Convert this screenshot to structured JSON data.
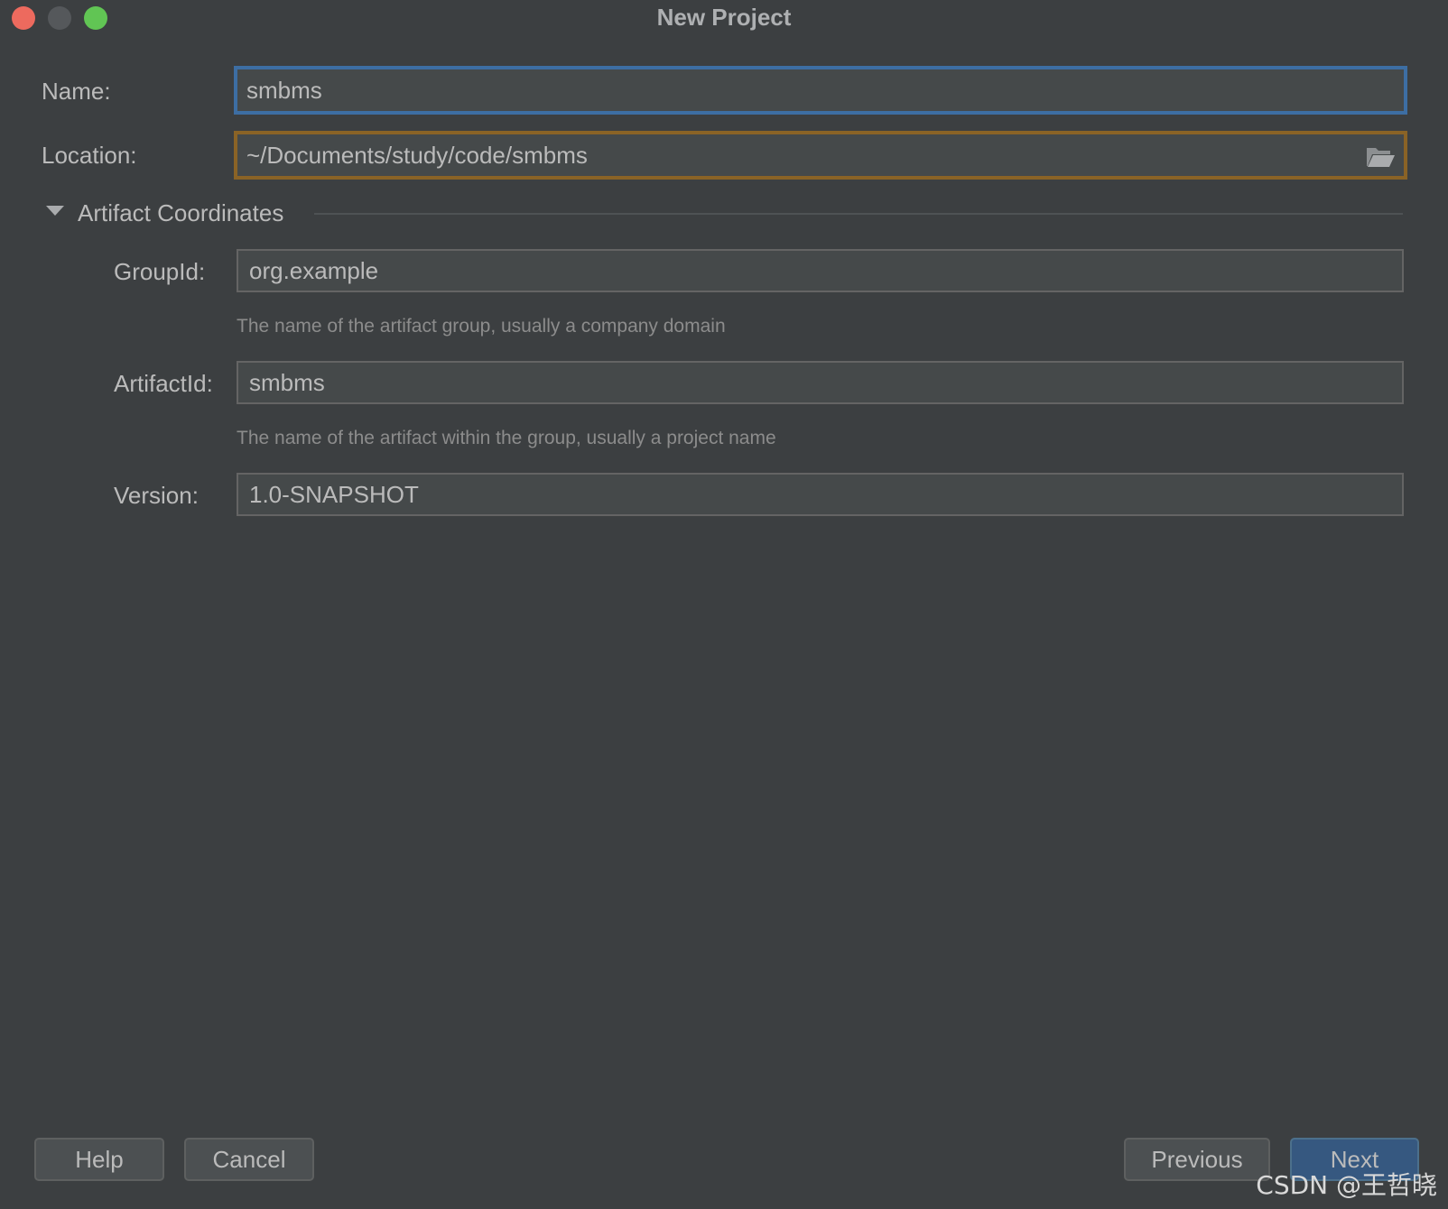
{
  "window": {
    "title": "New Project"
  },
  "form": {
    "name_label": "Name:",
    "name_value": "smbms",
    "location_label": "Location:",
    "location_value": "~/Documents/study/code/smbms",
    "location_browse_icon": "folder-open-icon"
  },
  "artifact": {
    "section_title": "Artifact Coordinates",
    "group_label": "GroupId:",
    "group_value": "org.example",
    "group_hint": "The name of the artifact group, usually a company domain",
    "artifact_label": "ArtifactId:",
    "artifact_value": "smbms",
    "artifact_hint": "The name of the artifact within the group, usually a project name",
    "version_label": "Version:",
    "version_value": "1.0-SNAPSHOT"
  },
  "footer": {
    "help_label": "Help",
    "cancel_label": "Cancel",
    "previous_label": "Previous",
    "next_label": "Next"
  },
  "watermark": "CSDN @王哲晓",
  "colors": {
    "background": "#3c3f41",
    "field_background": "#45494a",
    "focus_border": "#3d6ea3",
    "warning_border": "#8a6326",
    "primary_button": "#365880"
  }
}
